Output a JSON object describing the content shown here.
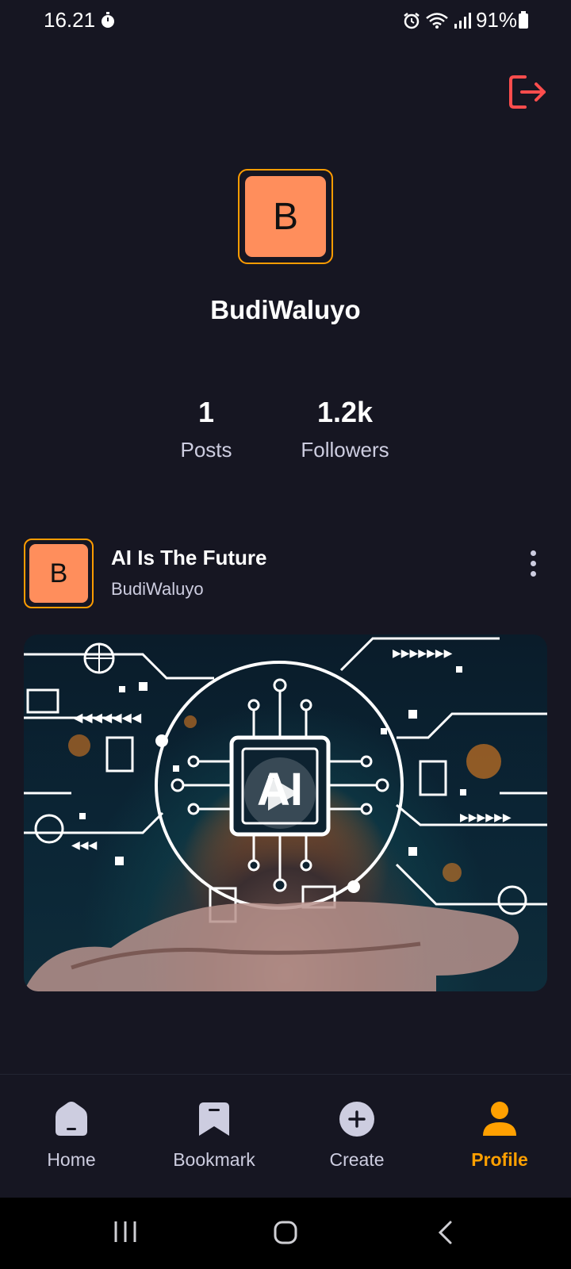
{
  "status_bar": {
    "time": "16.21",
    "battery": "91%"
  },
  "profile": {
    "avatar_initial": "B",
    "username": "BudiWaluyo",
    "stats": {
      "posts_count": "1",
      "posts_label": "Posts",
      "followers_count": "1.2k",
      "followers_label": "Followers"
    }
  },
  "posts": [
    {
      "avatar_initial": "B",
      "title": "AI Is The Future",
      "author": "BudiWaluyo",
      "thumbnail_text": "AI"
    }
  ],
  "bottom_nav": {
    "items": [
      {
        "label": "Home",
        "icon": "home-icon"
      },
      {
        "label": "Bookmark",
        "icon": "bookmark-icon"
      },
      {
        "label": "Create",
        "icon": "plus-circle-icon"
      },
      {
        "label": "Profile",
        "icon": "profile-icon"
      }
    ],
    "active": "Profile"
  },
  "colors": {
    "background": "#161622",
    "accent": "#FFA001",
    "avatar_fill": "#FF8E5C",
    "logout": "#FF4D4D",
    "muted_text": "#CDCDE0"
  }
}
